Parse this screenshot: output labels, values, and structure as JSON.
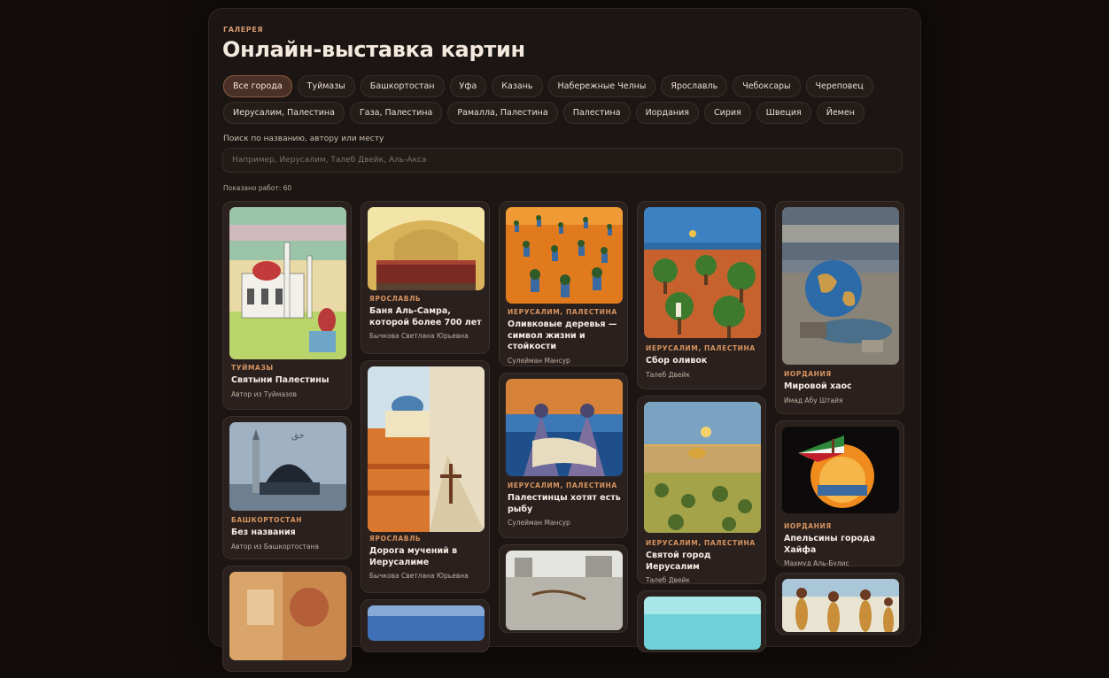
{
  "header": {
    "eyebrow": "ГАЛЕРЕЯ",
    "title": "Онлайн-выставка картин"
  },
  "filters": {
    "row1": [
      "Все города",
      "Туймазы",
      "Башкортостан",
      "Уфа",
      "Казань",
      "Набережные Челны",
      "Ярославль",
      "Чебоксары",
      "Череповец"
    ],
    "row2": [
      "Иерусалим, Палестина",
      "Газа, Палестина",
      "Рамалла, Палестина",
      "Палестина",
      "Иордания",
      "Сирия",
      "Швеция",
      "Йемен"
    ],
    "active": "Все города"
  },
  "search": {
    "label": "Поиск по названию, автору или месту",
    "placeholder": "Например, Иерусалим, Талеб Двейк, Аль-Акса",
    "value": ""
  },
  "results": {
    "count_text": "Показано работ: 60"
  },
  "columns": [
    [
      {
        "city": "ТУЙМАЗЫ",
        "title": "Святыни Палестины",
        "author": "Автор из Туймазов",
        "icon": "mosque-painting"
      },
      {
        "city": "БАШКОРТОСТАН",
        "title": "Без названия",
        "author": "Автор из Башкортостана",
        "icon": "dome-painting"
      },
      {
        "city": "",
        "title": "",
        "author": "",
        "icon": "abstract-painting"
      }
    ],
    [
      {
        "city": "ЯРОСЛАВЛЬ",
        "title": "Баня Аль-Самра, которой более 700 лет",
        "author": "Бычкова Светлана Юрьевна",
        "icon": "bath-hall-painting"
      },
      {
        "city": "ЯРОСЛАВЛЬ",
        "title": "Дорога мучений в Иерусалиме",
        "author": "Бычкова Светлана Юрьевна",
        "icon": "street-painting"
      },
      {
        "city": "",
        "title": "",
        "author": "",
        "icon": "blue-painting"
      }
    ],
    [
      {
        "city": "ИЕРУСАЛИМ, ПАЛЕСТИНА",
        "title": "Оливковые деревья — символ жизни и стойкости",
        "author": "Сулейман Мансур",
        "icon": "olive-cans-painting"
      },
      {
        "city": "ИЕРУСАЛИМ, ПАЛЕСТИНА",
        "title": "Палестинцы хотят есть рыбу",
        "author": "Сулейман Мансур",
        "icon": "fish-painting"
      },
      {
        "city": "",
        "title": "",
        "author": "",
        "icon": "wall-painting"
      }
    ],
    [
      {
        "city": "ИЕРУСАЛИМ, ПАЛЕСТИНА",
        "title": "Сбор оливок",
        "author": "Талеб Двейк",
        "icon": "olive-harvest-painting"
      },
      {
        "city": "ИЕРУСАЛИМ, ПАЛЕСТИНА",
        "title": "Святой город Иерусалим",
        "author": "Талеб Двейк",
        "icon": "city-painting"
      },
      {
        "city": "",
        "title": "",
        "author": "",
        "icon": "sky-painting"
      }
    ],
    [
      {
        "city": "ИОРДАНИЯ",
        "title": "Мировой хаос",
        "author": "Имад Абу Штайя",
        "icon": "globe-painting"
      },
      {
        "city": "ИОРДАНИЯ",
        "title": "Апельсины города Хайфа",
        "author": "Махмуд Аль-Булис",
        "icon": "orange-painting"
      },
      {
        "city": "",
        "title": "",
        "author": "",
        "icon": "figures-painting"
      }
    ]
  ]
}
